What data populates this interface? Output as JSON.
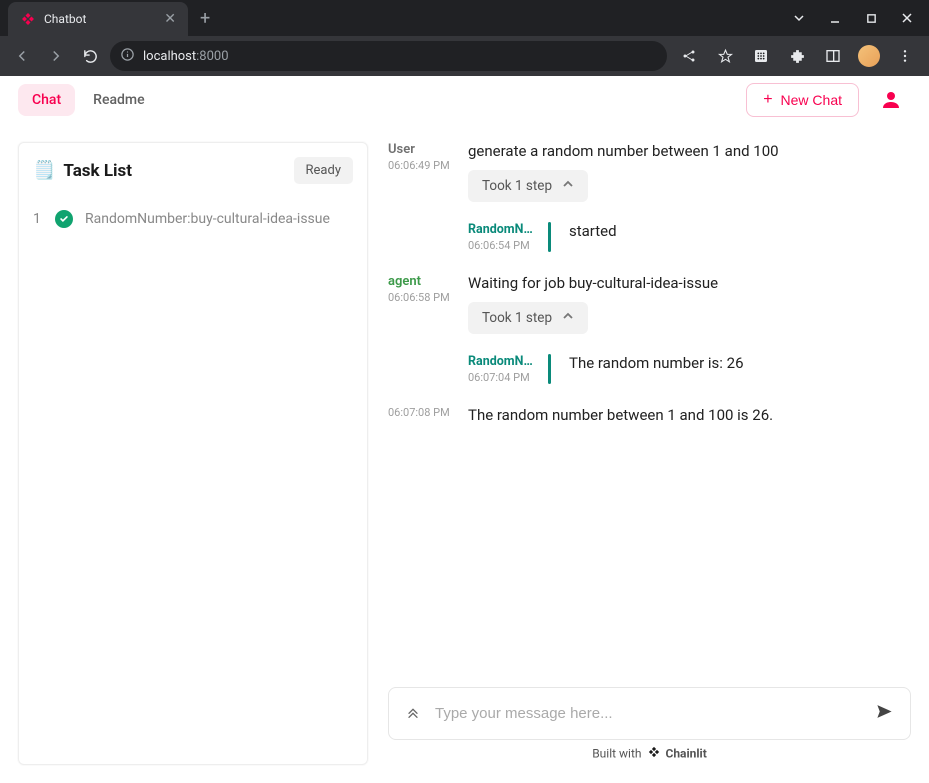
{
  "browser": {
    "tab_title": "Chatbot",
    "url_host": "localhost",
    "url_port": ":8000"
  },
  "header": {
    "tabs": [
      {
        "label": "Chat",
        "active": true
      },
      {
        "label": "Readme",
        "active": false
      }
    ],
    "new_chat_label": "New Chat"
  },
  "task_list": {
    "title": "Task List",
    "status": "Ready",
    "items": [
      {
        "index": "1",
        "name": "RandomNumber:buy-cultural-idea-issue",
        "done": true
      }
    ]
  },
  "messages": [
    {
      "sender": "User",
      "time": "06:06:49 PM",
      "text": "generate a random number between 1 and 100",
      "step_label": "Took 1 step",
      "substep": {
        "name": "RandomN...",
        "time": "06:06:54 PM",
        "text": "started"
      }
    },
    {
      "sender": "agent",
      "time": "06:06:58 PM",
      "text": "Waiting for job buy-cultural-idea-issue",
      "step_label": "Took 1 step",
      "substep": {
        "name": "RandomN...",
        "time": "06:07:04 PM",
        "text": "The random number is: 26"
      }
    }
  ],
  "final_message": {
    "time": "06:07:08 PM",
    "text": "The random number between 1 and 100 is 26."
  },
  "composer": {
    "placeholder": "Type your message here..."
  },
  "footer": {
    "prefix": "Built with",
    "brand": "Chainlit"
  }
}
